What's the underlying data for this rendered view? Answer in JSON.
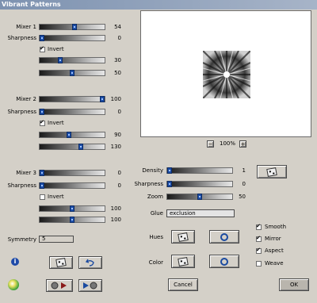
{
  "window": {
    "title": "Vibrant Patterns"
  },
  "left": {
    "mixer1": {
      "label": "Mixer 1",
      "value": "54",
      "level": 0.54
    },
    "sharpness1": {
      "label": "Sharpness",
      "value": "0",
      "level": 0.0
    },
    "invert1": {
      "label": "Invert",
      "checked": true
    },
    "slider1a": {
      "value": "30",
      "level": 0.3
    },
    "slider1b": {
      "value": "50",
      "level": 0.5
    },
    "mixer2": {
      "label": "Mixer 2",
      "value": "100",
      "level": 1.0
    },
    "sharpness2": {
      "label": "Sharpness",
      "value": "0",
      "level": 0.0
    },
    "invert2": {
      "label": "Invert",
      "checked": true
    },
    "slider2a": {
      "value": "90",
      "level": 0.45
    },
    "slider2b": {
      "value": "130",
      "level": 0.65
    },
    "mixer3": {
      "label": "Mixer 3",
      "value": "0",
      "level": 0.0
    },
    "sharpness3": {
      "label": "Sharpness",
      "value": "0",
      "level": 0.0
    },
    "invert3": {
      "label": "Invert",
      "checked": false
    },
    "slider3a": {
      "value": "100",
      "level": 0.5
    },
    "slider3b": {
      "value": "100",
      "level": 0.5
    },
    "symmetry": {
      "label": "Symmetry",
      "value": "5"
    }
  },
  "preview": {
    "zoom": "100%"
  },
  "right": {
    "density": {
      "label": "Density",
      "value": "1",
      "level": 0.0
    },
    "sharpness": {
      "label": "Sharpness",
      "value": "0",
      "level": 0.0
    },
    "zoom": {
      "label": "Zoom",
      "value": "50",
      "level": 0.5
    },
    "glue": {
      "label": "Glue",
      "value": "exclusion"
    },
    "hues": {
      "label": "Hues"
    },
    "color": {
      "label": "Color"
    },
    "checks": {
      "smooth": {
        "label": "Smooth",
        "checked": true
      },
      "mirror": {
        "label": "Mirror",
        "checked": true
      },
      "aspect": {
        "label": "Aspect",
        "checked": true
      },
      "weave": {
        "label": "Weave",
        "checked": false
      }
    }
  },
  "buttons": {
    "cancel": "Cancel",
    "ok": "OK"
  }
}
